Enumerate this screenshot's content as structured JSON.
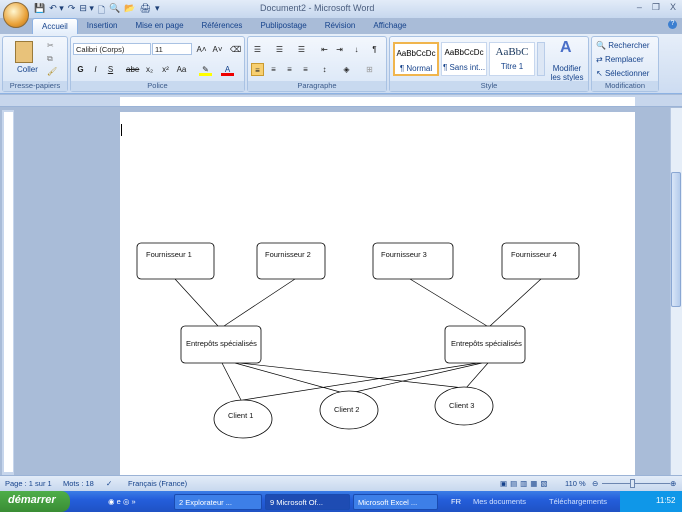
{
  "window": {
    "title": "Document2 - Microsoft Word",
    "minimize": "–",
    "restore": "❐",
    "close": "X"
  },
  "qat": [
    "💾",
    "↶ ▾",
    "↷",
    "⊟ ▾",
    "🗋",
    "🔍",
    "📂",
    "🖨",
    "▾"
  ],
  "tabs": [
    "Accueil",
    "Insertion",
    "Mise en page",
    "Références",
    "Publipostage",
    "Révision",
    "Affichage"
  ],
  "ribbon": {
    "clipboard": {
      "paste": "Coller",
      "label": "Presse-papiers"
    },
    "font": {
      "name": "Calibri (Corps)",
      "size": "11",
      "label": "Police",
      "buttons": [
        "G",
        "I",
        "S",
        "abe",
        "x₂",
        "x²",
        "Aa"
      ]
    },
    "paragraph": {
      "label": "Paragraphe"
    },
    "style": {
      "label": "Style",
      "items": [
        {
          "preview": "AaBbCcDc",
          "name": "¶ Normal"
        },
        {
          "preview": "AaBbCcDc",
          "name": "¶ Sans int..."
        },
        {
          "preview": "AaBbC",
          "name": "Titre 1"
        }
      ],
      "modify": "Modifier les styles"
    },
    "editing": {
      "label": "Modification",
      "find": "Rechercher",
      "replace": "Remplacer",
      "select": "Sélectionner"
    }
  },
  "diagram": {
    "suppliers": [
      "Fournisseur 1",
      "Fournisseur 2",
      "Fournisseur 3",
      "Fournisseur 4"
    ],
    "warehouses": [
      "Entrepôts spécialisés",
      "Entrepôts spécialisés"
    ],
    "clients": [
      "Client 1",
      "Client 2",
      "Client 3"
    ]
  },
  "status": {
    "page": "Page : 1 sur 1",
    "words": "Mots : 18",
    "language": "Français (France)",
    "zoom": "110 %"
  },
  "taskbar": {
    "start": "démarrer",
    "tasks": [
      "2 Explorateur ...",
      "9 Microsoft Of...",
      "Microsoft Excel ..."
    ],
    "lang": "FR",
    "docs": "Mes documents",
    "downloads": "Téléchargements",
    "clock": "11:52"
  }
}
